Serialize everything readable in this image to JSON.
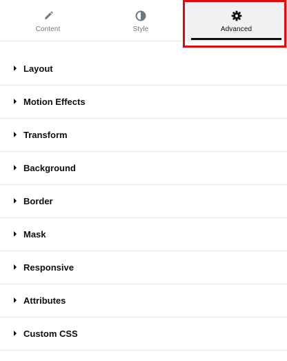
{
  "tabs": [
    {
      "label": "Content",
      "icon": "pencil-icon",
      "active": false
    },
    {
      "label": "Style",
      "icon": "half-circle-icon",
      "active": false
    },
    {
      "label": "Advanced",
      "icon": "gear-icon",
      "active": true
    }
  ],
  "sections": [
    {
      "title": "Layout"
    },
    {
      "title": "Motion Effects"
    },
    {
      "title": "Transform"
    },
    {
      "title": "Background"
    },
    {
      "title": "Border"
    },
    {
      "title": "Mask"
    },
    {
      "title": "Responsive"
    },
    {
      "title": "Attributes"
    },
    {
      "title": "Custom CSS"
    }
  ],
  "colors": {
    "highlight": "#e4070c",
    "text_dark": "#0c0d0e",
    "text_muted": "#6d7882",
    "active_tab_bg": "#f0f1f3",
    "divider": "#e6e8ea"
  }
}
